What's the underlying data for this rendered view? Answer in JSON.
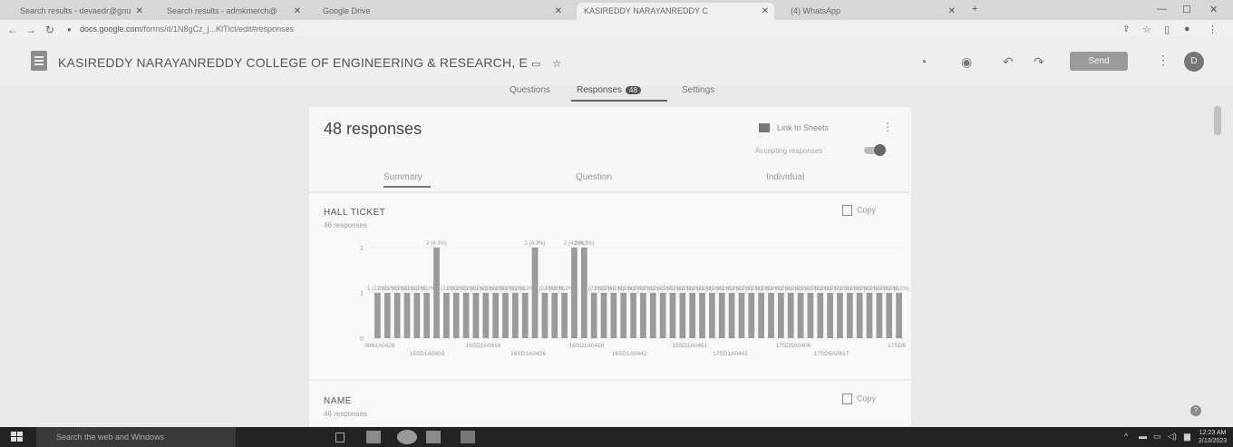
{
  "browser": {
    "tabs": [
      {
        "label": "Search results - devaedr@gnu"
      },
      {
        "label": "Search results - admkmerch@"
      },
      {
        "label": "Google Drive"
      },
      {
        "label": "KASIREDDY NARAYANREDDY C"
      },
      {
        "label": "(4) WhatsApp"
      }
    ],
    "url_host": "docs.google.com",
    "url_path": "/forms/d/1N8gCz_j...KlTlct/edit#responses"
  },
  "header": {
    "form_title": "KASIREDDY NARAYANREDDY COLLEGE OF ENGINEERING & RESEARCH, E",
    "send_label": "Send",
    "avatar_letter": "D"
  },
  "subtabs": {
    "questions": "Questions",
    "responses": "Responses",
    "responses_count": "48",
    "settings": "Settings"
  },
  "summary": {
    "title": "48 responses",
    "link_to_sheets": "Link to Sheets",
    "accepting": "Accepting responses",
    "tabs": {
      "summary": "Summary",
      "question": "Question",
      "individual": "Individual"
    }
  },
  "questions": [
    {
      "label": "HALL TICKET",
      "count": "46 responses",
      "copy": "Copy"
    },
    {
      "label": "NAME",
      "count": "46 responses",
      "copy": "Copy"
    }
  ],
  "chart_data": {
    "type": "bar",
    "ylim": [
      0,
      2
    ],
    "yticks": [
      0,
      1,
      2
    ],
    "values": [
      1,
      1,
      1,
      1,
      1,
      1,
      2,
      1,
      1,
      1,
      1,
      1,
      1,
      1,
      1,
      1,
      2,
      1,
      1,
      1,
      2,
      2,
      1,
      1,
      1,
      1,
      1,
      1,
      1,
      1,
      1,
      1,
      1,
      1,
      1,
      1,
      1,
      1,
      1,
      1,
      1,
      1,
      1,
      1,
      1,
      1,
      1,
      1,
      1,
      1,
      1,
      1,
      1,
      1
    ],
    "data_labels": {
      "one": "1 (2.2%)",
      "two": "2 (4.3%)"
    },
    "tick_labels_row1": [
      "0861A0428",
      "16SD1A0416",
      "16SD1A0428",
      "16SD1A0461",
      "17SD5A0406",
      "17SD6"
    ],
    "tick_labels_row2": [
      "16SD1A0403",
      "16SD1A0426",
      "16SD1A0442",
      "17SD1A0402",
      "17SD5A0417"
    ]
  },
  "taskbar": {
    "search_placeholder": "Search the web and Windows",
    "time": "12:23 AM",
    "date": "2/13/2023"
  },
  "colors": {
    "bar": "#9a9a9a",
    "background": "#e9e9e9"
  }
}
